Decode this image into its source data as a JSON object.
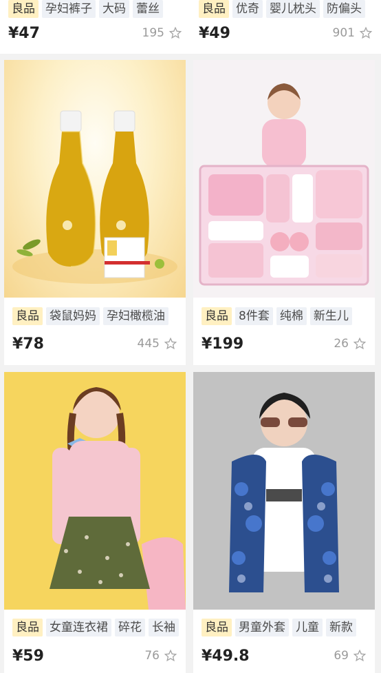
{
  "products": [
    {
      "tags": [
        "良品",
        "孕妇裤子",
        "大码",
        "蕾丝"
      ],
      "price": "¥47",
      "likes": "195"
    },
    {
      "tags": [
        "良品",
        "优奇",
        "婴儿枕头",
        "防偏头"
      ],
      "price": "¥49",
      "likes": "901"
    },
    {
      "tags": [
        "良品",
        "袋鼠妈妈",
        "孕妇橄榄油"
      ],
      "price": "¥78",
      "likes": "445"
    },
    {
      "tags": [
        "良品",
        "8件套",
        "纯棉",
        "新生儿"
      ],
      "price": "¥199",
      "likes": "26"
    },
    {
      "tags": [
        "良品",
        "女童连衣裙",
        "碎花",
        "长袖"
      ],
      "price": "¥59",
      "likes": "76"
    },
    {
      "tags": [
        "良品",
        "男童外套",
        "儿童",
        "新款"
      ],
      "price": "¥49.8",
      "likes": "69"
    }
  ],
  "icons": {
    "like": "star-outline-icon"
  },
  "colors": {
    "good_tag_bg": "#fff0c2",
    "tag_bg": "#eef1f6",
    "price": "#222222",
    "meta": "#9a9a9a"
  }
}
